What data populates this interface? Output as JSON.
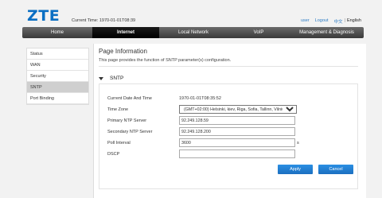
{
  "header": {
    "logo": "ZTE",
    "current_time_label": "Current Time: 1970-01-01T08:39",
    "user": "user",
    "logout": "Logout",
    "lang_cn": "中文",
    "lang_sep": "|",
    "lang_en": "English"
  },
  "nav": {
    "tabs": [
      {
        "label": "Home"
      },
      {
        "label": "Internet"
      },
      {
        "label": "Local Network"
      },
      {
        "label": "VoIP"
      },
      {
        "label": "Management & Diagnosis"
      }
    ],
    "active": "Internet"
  },
  "sidebar": {
    "items": [
      {
        "label": "Status"
      },
      {
        "label": "WAN"
      },
      {
        "label": "Security"
      },
      {
        "label": "SNTP"
      },
      {
        "label": "Port Binding"
      }
    ],
    "active": "SNTP"
  },
  "main": {
    "title": "Page Information",
    "description": "This page provides the function of SNTP parameter(s) configuration.",
    "section_title": "SNTP",
    "fields": {
      "current_date_label": "Current Date And Time",
      "current_date_value": "1970-01-01T08:35:52",
      "time_zone_label": "Time Zone",
      "time_zone_value": "(GMT+02:00) Helsinki, kiev, Riga, Sofia, Tallinn, Vilnius",
      "primary_ntp_label": "Primary NTP Server",
      "primary_ntp_value": "92.249.128.59",
      "secondary_ntp_label": "Secondary NTP Server",
      "secondary_ntp_value": "92.249.128.200",
      "poll_interval_label": "Poll Interval",
      "poll_interval_value": "3600",
      "poll_interval_unit": "s",
      "dscp_label": "DSCP",
      "dscp_value": ""
    },
    "apply_label": "Apply",
    "cancel_label": "Cancel"
  },
  "colors": {
    "brand": "#0b6fc3",
    "button": "#1f7fd6",
    "nav_bg": "#4a4a4a",
    "nav_active": "#000000"
  }
}
